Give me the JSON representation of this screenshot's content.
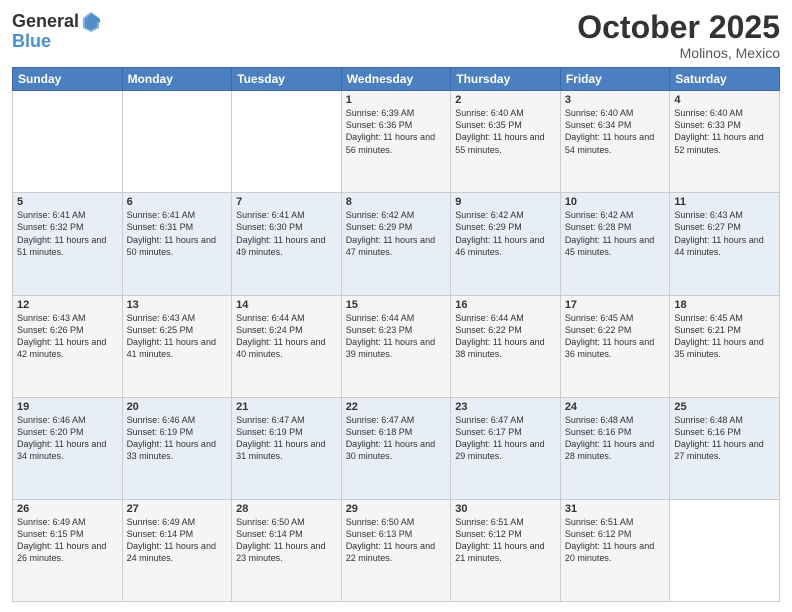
{
  "header": {
    "logo": {
      "general": "General",
      "blue": "Blue"
    },
    "title": "October 2025",
    "subtitle": "Molinos, Mexico"
  },
  "weekdays": [
    "Sunday",
    "Monday",
    "Tuesday",
    "Wednesday",
    "Thursday",
    "Friday",
    "Saturday"
  ],
  "weeks": [
    [
      {
        "day": "",
        "sunrise": "",
        "sunset": "",
        "daylight": ""
      },
      {
        "day": "",
        "sunrise": "",
        "sunset": "",
        "daylight": ""
      },
      {
        "day": "",
        "sunrise": "",
        "sunset": "",
        "daylight": ""
      },
      {
        "day": "1",
        "sunrise": "Sunrise: 6:39 AM",
        "sunset": "Sunset: 6:36 PM",
        "daylight": "Daylight: 11 hours and 56 minutes."
      },
      {
        "day": "2",
        "sunrise": "Sunrise: 6:40 AM",
        "sunset": "Sunset: 6:35 PM",
        "daylight": "Daylight: 11 hours and 55 minutes."
      },
      {
        "day": "3",
        "sunrise": "Sunrise: 6:40 AM",
        "sunset": "Sunset: 6:34 PM",
        "daylight": "Daylight: 11 hours and 54 minutes."
      },
      {
        "day": "4",
        "sunrise": "Sunrise: 6:40 AM",
        "sunset": "Sunset: 6:33 PM",
        "daylight": "Daylight: 11 hours and 52 minutes."
      }
    ],
    [
      {
        "day": "5",
        "sunrise": "Sunrise: 6:41 AM",
        "sunset": "Sunset: 6:32 PM",
        "daylight": "Daylight: 11 hours and 51 minutes."
      },
      {
        "day": "6",
        "sunrise": "Sunrise: 6:41 AM",
        "sunset": "Sunset: 6:31 PM",
        "daylight": "Daylight: 11 hours and 50 minutes."
      },
      {
        "day": "7",
        "sunrise": "Sunrise: 6:41 AM",
        "sunset": "Sunset: 6:30 PM",
        "daylight": "Daylight: 11 hours and 49 minutes."
      },
      {
        "day": "8",
        "sunrise": "Sunrise: 6:42 AM",
        "sunset": "Sunset: 6:29 PM",
        "daylight": "Daylight: 11 hours and 47 minutes."
      },
      {
        "day": "9",
        "sunrise": "Sunrise: 6:42 AM",
        "sunset": "Sunset: 6:29 PM",
        "daylight": "Daylight: 11 hours and 46 minutes."
      },
      {
        "day": "10",
        "sunrise": "Sunrise: 6:42 AM",
        "sunset": "Sunset: 6:28 PM",
        "daylight": "Daylight: 11 hours and 45 minutes."
      },
      {
        "day": "11",
        "sunrise": "Sunrise: 6:43 AM",
        "sunset": "Sunset: 6:27 PM",
        "daylight": "Daylight: 11 hours and 44 minutes."
      }
    ],
    [
      {
        "day": "12",
        "sunrise": "Sunrise: 6:43 AM",
        "sunset": "Sunset: 6:26 PM",
        "daylight": "Daylight: 11 hours and 42 minutes."
      },
      {
        "day": "13",
        "sunrise": "Sunrise: 6:43 AM",
        "sunset": "Sunset: 6:25 PM",
        "daylight": "Daylight: 11 hours and 41 minutes."
      },
      {
        "day": "14",
        "sunrise": "Sunrise: 6:44 AM",
        "sunset": "Sunset: 6:24 PM",
        "daylight": "Daylight: 11 hours and 40 minutes."
      },
      {
        "day": "15",
        "sunrise": "Sunrise: 6:44 AM",
        "sunset": "Sunset: 6:23 PM",
        "daylight": "Daylight: 11 hours and 39 minutes."
      },
      {
        "day": "16",
        "sunrise": "Sunrise: 6:44 AM",
        "sunset": "Sunset: 6:22 PM",
        "daylight": "Daylight: 11 hours and 38 minutes."
      },
      {
        "day": "17",
        "sunrise": "Sunrise: 6:45 AM",
        "sunset": "Sunset: 6:22 PM",
        "daylight": "Daylight: 11 hours and 36 minutes."
      },
      {
        "day": "18",
        "sunrise": "Sunrise: 6:45 AM",
        "sunset": "Sunset: 6:21 PM",
        "daylight": "Daylight: 11 hours and 35 minutes."
      }
    ],
    [
      {
        "day": "19",
        "sunrise": "Sunrise: 6:46 AM",
        "sunset": "Sunset: 6:20 PM",
        "daylight": "Daylight: 11 hours and 34 minutes."
      },
      {
        "day": "20",
        "sunrise": "Sunrise: 6:46 AM",
        "sunset": "Sunset: 6:19 PM",
        "daylight": "Daylight: 11 hours and 33 minutes."
      },
      {
        "day": "21",
        "sunrise": "Sunrise: 6:47 AM",
        "sunset": "Sunset: 6:19 PM",
        "daylight": "Daylight: 11 hours and 31 minutes."
      },
      {
        "day": "22",
        "sunrise": "Sunrise: 6:47 AM",
        "sunset": "Sunset: 6:18 PM",
        "daylight": "Daylight: 11 hours and 30 minutes."
      },
      {
        "day": "23",
        "sunrise": "Sunrise: 6:47 AM",
        "sunset": "Sunset: 6:17 PM",
        "daylight": "Daylight: 11 hours and 29 minutes."
      },
      {
        "day": "24",
        "sunrise": "Sunrise: 6:48 AM",
        "sunset": "Sunset: 6:16 PM",
        "daylight": "Daylight: 11 hours and 28 minutes."
      },
      {
        "day": "25",
        "sunrise": "Sunrise: 6:48 AM",
        "sunset": "Sunset: 6:16 PM",
        "daylight": "Daylight: 11 hours and 27 minutes."
      }
    ],
    [
      {
        "day": "26",
        "sunrise": "Sunrise: 6:49 AM",
        "sunset": "Sunset: 6:15 PM",
        "daylight": "Daylight: 11 hours and 26 minutes."
      },
      {
        "day": "27",
        "sunrise": "Sunrise: 6:49 AM",
        "sunset": "Sunset: 6:14 PM",
        "daylight": "Daylight: 11 hours and 24 minutes."
      },
      {
        "day": "28",
        "sunrise": "Sunrise: 6:50 AM",
        "sunset": "Sunset: 6:14 PM",
        "daylight": "Daylight: 11 hours and 23 minutes."
      },
      {
        "day": "29",
        "sunrise": "Sunrise: 6:50 AM",
        "sunset": "Sunset: 6:13 PM",
        "daylight": "Daylight: 11 hours and 22 minutes."
      },
      {
        "day": "30",
        "sunrise": "Sunrise: 6:51 AM",
        "sunset": "Sunset: 6:12 PM",
        "daylight": "Daylight: 11 hours and 21 minutes."
      },
      {
        "day": "31",
        "sunrise": "Sunrise: 6:51 AM",
        "sunset": "Sunset: 6:12 PM",
        "daylight": "Daylight: 11 hours and 20 minutes."
      },
      {
        "day": "",
        "sunrise": "",
        "sunset": "",
        "daylight": ""
      }
    ]
  ]
}
